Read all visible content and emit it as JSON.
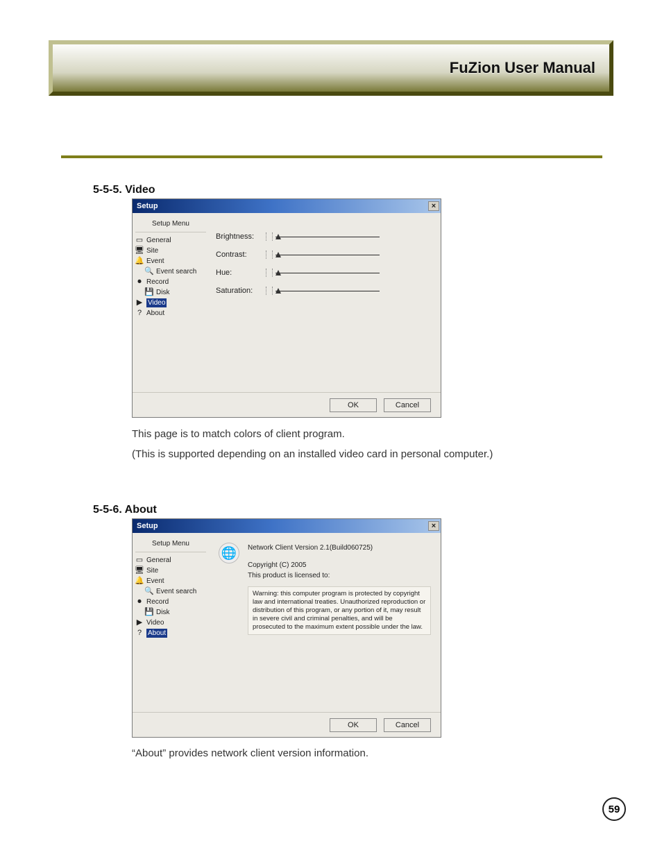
{
  "header": {
    "title": "FuZion User Manual"
  },
  "section1": {
    "heading": "5-5-5. Video",
    "caption1": "This page is to match colors of client program.",
    "caption2": "(This is supported depending on an installed video card in personal computer.)"
  },
  "section2": {
    "heading": "5-5-6. About",
    "caption": "“About” provides network client version information."
  },
  "dialog": {
    "title": "Setup",
    "close": "×",
    "menu_header": "Setup Menu",
    "tree": {
      "general": "General",
      "site": "Site",
      "event": "Event",
      "event_search": "Event search",
      "record": "Record",
      "disk": "Disk",
      "video": "Video",
      "about": "About"
    },
    "ok": "OK",
    "cancel": "Cancel"
  },
  "video_sliders": {
    "brightness": "Brightness:",
    "contrast": "Contrast:",
    "hue": "Hue:",
    "saturation": "Saturation:"
  },
  "about_panel": {
    "line1": "Network Client Version 2.1(Build060725)",
    "line2": "Copyright (C) 2005",
    "line3": "This product is licensed to:",
    "warning": "Warning: this computer program is protected by copyright law and international treaties. Unauthorized reproduction or distribution of this program, or any portion of it, may result in severe civil and criminal penalties, and will be prosecuted to the maximum extent possible under the law."
  },
  "page": {
    "number": "59"
  }
}
